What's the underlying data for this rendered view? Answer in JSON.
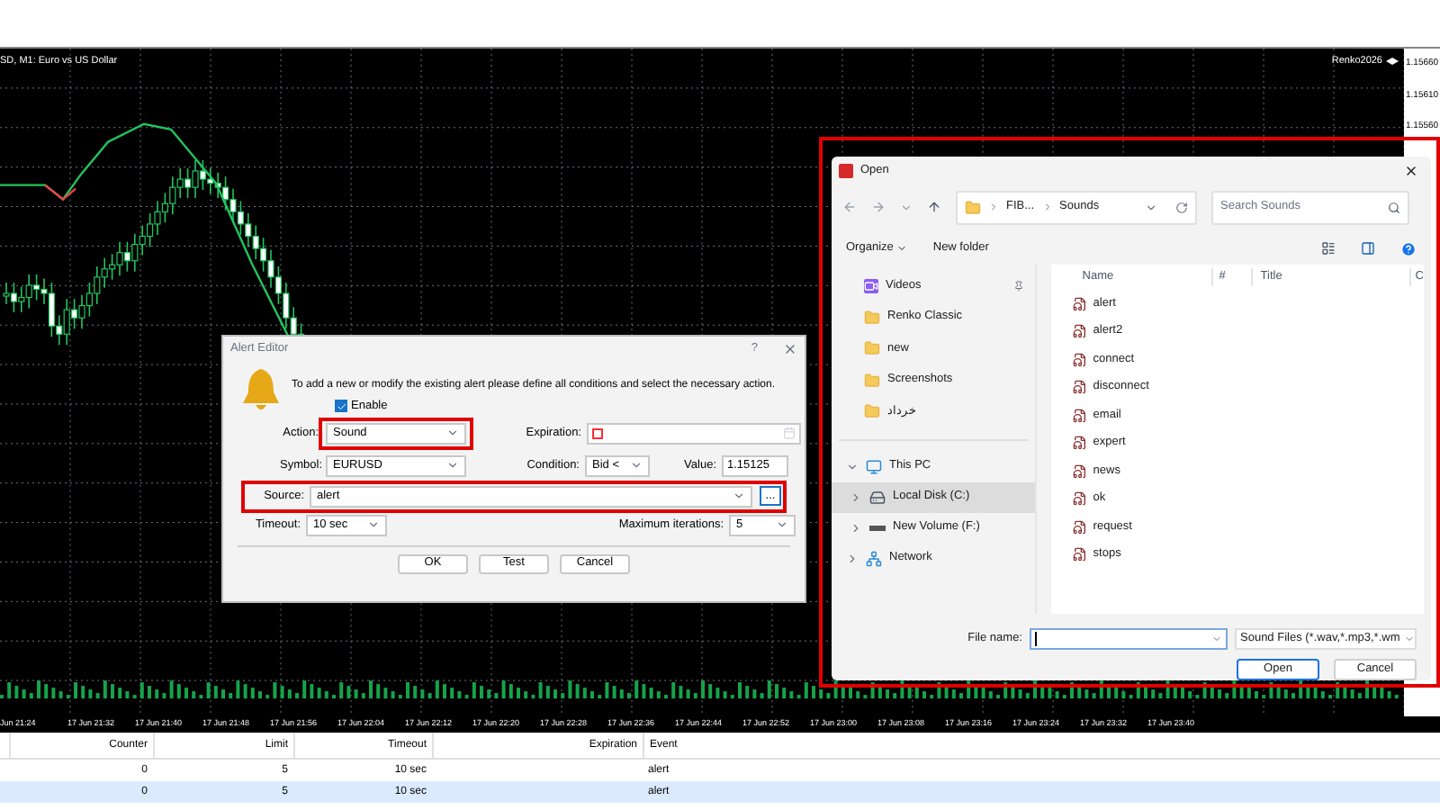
{
  "chart": {
    "title": "SD, M1:  Euro vs US Dollar",
    "account": "Renko2026",
    "price_labels": [
      "1.15660",
      "1.15610",
      "1.15560"
    ],
    "time_labels": [
      "Jun 21:24",
      "17 Jun 21:32",
      "17 Jun 21:40",
      "17 Jun 21:48",
      "17 Jun 21:56",
      "17 Jun 22:04",
      "17 Jun 22:12",
      "17 Jun 22:20",
      "17 Jun 22:28",
      "17 Jun 22:36",
      "17 Jun 22:44",
      "17 Jun 22:52",
      "17 Jun 23:00",
      "17 Jun 23:08",
      "17 Jun 23:16",
      "17 Jun 23:24",
      "17 Jun 23:32",
      "17 Jun 23:40"
    ]
  },
  "alert_editor": {
    "title": "Alert Editor",
    "help": "?",
    "intro": "To add a new or modify the existing alert please define all conditions and select the necessary action.",
    "enable": {
      "label": "Enable",
      "checked": true
    },
    "action": {
      "label": "Action:",
      "value": "Sound",
      "highlighted": true
    },
    "expiration": {
      "label": "Expiration:"
    },
    "symbol": {
      "label": "Symbol:",
      "value": "EURUSD"
    },
    "condition": {
      "label": "Condition:",
      "value": "Bid <"
    },
    "value": {
      "label": "Value:",
      "value": "1.15125"
    },
    "source": {
      "label": "Source:",
      "value": "alert",
      "browse": "...",
      "highlighted": true
    },
    "timeout": {
      "label": "Timeout:",
      "value": "10 sec"
    },
    "iterations": {
      "label": "Maximum iterations:",
      "value": "5"
    },
    "buttons": [
      "OK",
      "Test",
      "Cancel"
    ]
  },
  "open_dialog": {
    "title": "Open",
    "highlighted": true,
    "path": [
      "FIB...",
      "Sounds"
    ],
    "search": {
      "placeholder": "Search Sounds"
    },
    "toolbar": {
      "organize": "Organize",
      "new_folder": "New folder"
    },
    "sidebar": [
      {
        "label": "Videos",
        "kind": "videos",
        "pinned": true,
        "selected": false
      },
      {
        "label": "Renko Classic",
        "kind": "folder",
        "selected": false
      },
      {
        "label": "new",
        "kind": "folder",
        "selected": false
      },
      {
        "label": "Screenshots",
        "kind": "folder",
        "selected": false
      },
      {
        "label": "خرداد",
        "kind": "folder",
        "selected": false
      }
    ],
    "tree": [
      {
        "label": "This PC",
        "kind": "pc",
        "expanded": true,
        "selected": false,
        "children": [
          {
            "label": "Local Disk (C:)",
            "kind": "disk",
            "expanded": false,
            "selected": true
          },
          {
            "label": "New Volume (F:)",
            "kind": "drive",
            "expanded": false,
            "selected": false
          }
        ]
      },
      {
        "label": "Network",
        "kind": "network",
        "expanded": false,
        "selected": false
      }
    ],
    "columns": [
      "Name",
      "#",
      "Title",
      "C"
    ],
    "files": [
      "alert",
      "alert2",
      "connect",
      "disconnect",
      "email",
      "expert",
      "news",
      "ok",
      "request",
      "stops"
    ],
    "file_name": {
      "label": "File name:"
    },
    "filter": "Sound Files (*.wav,*.mp3,*.wm",
    "buttons": [
      "Open",
      "Cancel"
    ]
  },
  "alerts_table": {
    "columns": [
      "Counter",
      "Limit",
      "Timeout",
      "Expiration",
      "Event"
    ],
    "rows": [
      {
        "cells": [
          "0",
          "5",
          "10 sec",
          "",
          "alert"
        ],
        "selected": false
      },
      {
        "cells": [
          "0",
          "5",
          "10 sec",
          "",
          "alert"
        ],
        "selected": true
      }
    ]
  }
}
